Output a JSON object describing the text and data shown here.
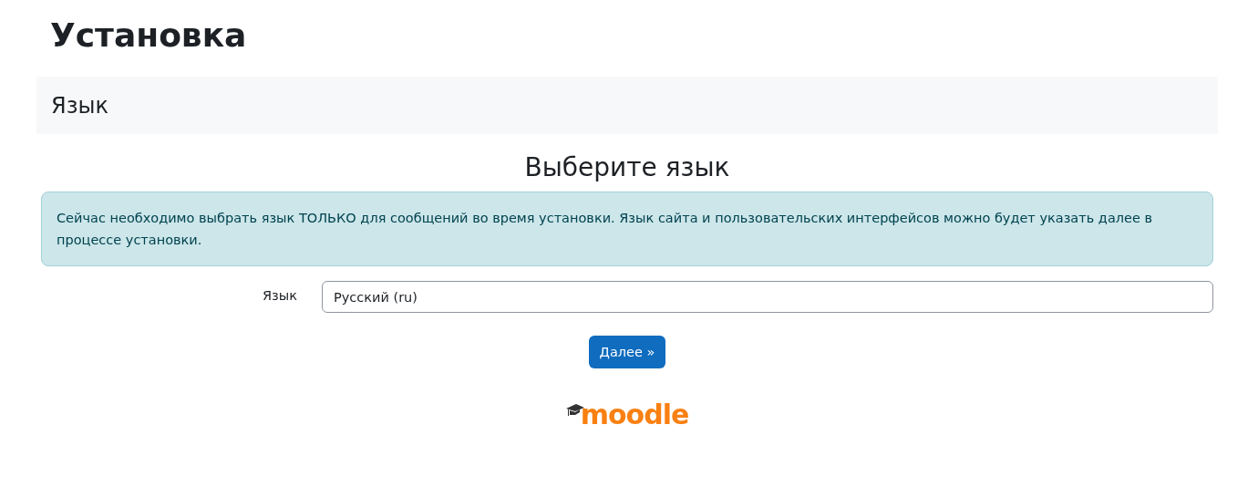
{
  "page_title": "Установка",
  "section_heading": "Язык",
  "form_heading": "Выберите язык",
  "notice": "Сейчас необходимо выбрать язык ТОЛЬКО для сообщений во время установки. Язык сайта и пользовательских интерфейсов можно будет указать далее в процессе установки.",
  "language_field": {
    "label": "Язык",
    "value": "Русский (ru)"
  },
  "next_button": "Далее »",
  "logo": {
    "text": "moodle"
  }
}
